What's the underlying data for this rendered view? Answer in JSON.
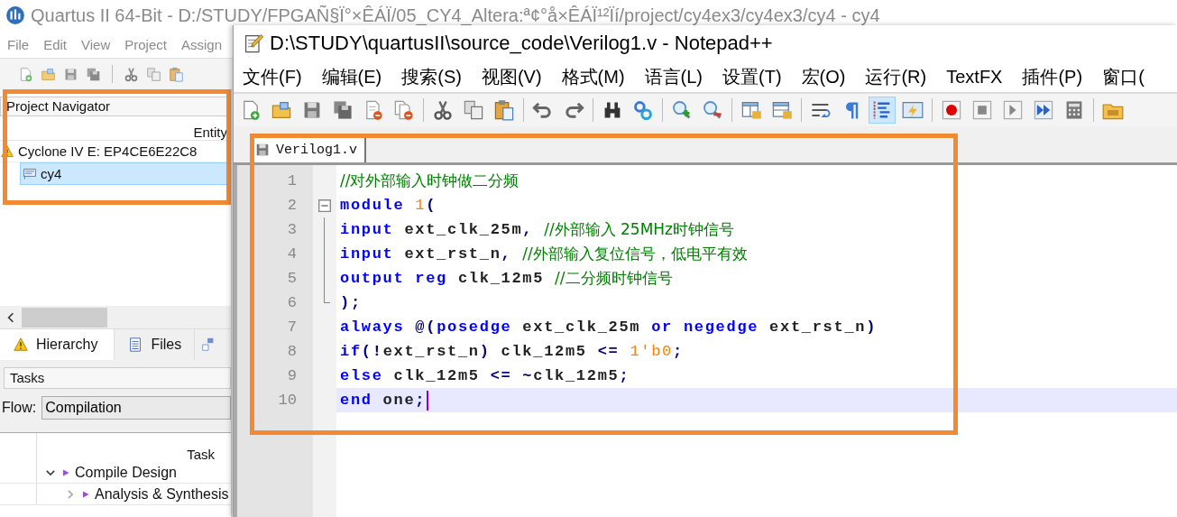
{
  "quartus": {
    "title": "Quartus II 64-Bit - D:/STUDY/FPGAÑ§Ï°×ÊÁÏ/05_CY4_Altera:ª¢°å×ÊÁÏ¹²Ïí/project/cy4ex3/cy4ex3/cy4 - cy4",
    "menu": [
      "File",
      "Edit",
      "View",
      "Project",
      "Assign"
    ],
    "toolbar": [
      {
        "kind": "new"
      },
      {
        "kind": "open"
      },
      {
        "kind": "save"
      },
      {
        "kind": "save-all"
      },
      {
        "kind": "separator"
      },
      {
        "kind": "cut"
      },
      {
        "kind": "copy"
      },
      {
        "kind": "paste"
      }
    ],
    "project_navigator": {
      "title": "Project Navigator",
      "highlighted": true,
      "column": "Entity",
      "tree": [
        {
          "label": "Cyclone IV E: EP4CE6E22C8",
          "kind": "device",
          "selected": false,
          "children": [
            {
              "label": "cy4",
              "kind": "entity",
              "selected": true
            }
          ]
        }
      ]
    },
    "tabs": [
      {
        "label": "Hierarchy",
        "kind": "hierarchy",
        "selected": true
      },
      {
        "label": "Files",
        "kind": "files",
        "selected": false
      },
      {
        "kind": "units",
        "selected": false
      }
    ],
    "tasks": {
      "title": "Tasks",
      "flow_label": "Flow:",
      "flow": "Compilation",
      "column": "Task",
      "rows": [
        {
          "label": "Compile Design",
          "expanded": true,
          "children": [
            {
              "label": "Analysis & Synthesis",
              "expanded": false
            }
          ]
        }
      ]
    }
  },
  "notepad": {
    "title": "D:\\STUDY\\quartusII\\source_code\\Verilog1.v - Notepad++",
    "menu": [
      "文件(F)",
      "编辑(E)",
      "搜索(S)",
      "视图(V)",
      "格式(M)",
      "语言(L)",
      "设置(T)",
      "宏(O)",
      "运行(R)",
      "TextFX",
      "插件(P)",
      "窗口("
    ],
    "toolbar": [
      {
        "kind": "new",
        "selected": false
      },
      {
        "kind": "open",
        "selected": false
      },
      {
        "kind": "save",
        "selected": false
      },
      {
        "kind": "save-all",
        "selected": false
      },
      {
        "kind": "close",
        "selected": false
      },
      {
        "kind": "close-all",
        "selected": false
      },
      {
        "kind": "separator"
      },
      {
        "kind": "cut",
        "selected": false
      },
      {
        "kind": "copy",
        "selected": false
      },
      {
        "kind": "paste",
        "selected": false
      },
      {
        "kind": "separator"
      },
      {
        "kind": "undo",
        "selected": false
      },
      {
        "kind": "redo",
        "selected": false
      },
      {
        "kind": "separator"
      },
      {
        "kind": "find",
        "selected": false
      },
      {
        "kind": "replace",
        "selected": false
      },
      {
        "kind": "separator"
      },
      {
        "kind": "zoom-in",
        "selected": false
      },
      {
        "kind": "zoom-out",
        "selected": false
      },
      {
        "kind": "separator"
      },
      {
        "kind": "sync-v",
        "selected": false
      },
      {
        "kind": "sync-h",
        "selected": false
      },
      {
        "kind": "separator"
      },
      {
        "kind": "wrap",
        "selected": false
      },
      {
        "kind": "all-chars",
        "selected": false
      },
      {
        "kind": "indent-guide",
        "selected": true
      },
      {
        "kind": "udl",
        "selected": false
      },
      {
        "kind": "separator"
      },
      {
        "kind": "record",
        "selected": false
      },
      {
        "kind": "stop",
        "selected": false
      },
      {
        "kind": "play",
        "selected": false
      },
      {
        "kind": "play-multi",
        "selected": false
      },
      {
        "kind": "save-macro",
        "selected": false
      },
      {
        "kind": "separator"
      },
      {
        "kind": "folder",
        "selected": false
      }
    ],
    "tabs": [
      {
        "label": "Verilog1.v",
        "selected": true
      }
    ],
    "editor": {
      "highlighted": true,
      "lines": [
        {
          "number": "1",
          "current": false,
          "tokens": [
            {
              "text": "//对外部输入时钟做二分频",
              "kind": "comment"
            }
          ]
        },
        {
          "number": "2",
          "current": false,
          "expanded": true,
          "tokens": [
            {
              "text": "module ",
              "kind": "keyword"
            },
            {
              "text": "1",
              "kind": "number"
            },
            {
              "text": "(",
              "kind": "op"
            }
          ],
          "children": [
            {
              "number": "3",
              "current": false,
              "tokens": [
                {
                  "text": "input",
                  "kind": "keyword"
                },
                {
                  "text": " ext_clk_25m",
                  "kind": "plain"
                },
                {
                  "text": ", ",
                  "kind": "op"
                },
                {
                  "text": "//外部输入 25MHz时钟信号",
                  "kind": "comment"
                }
              ]
            },
            {
              "number": "4",
              "current": false,
              "tokens": [
                {
                  "text": "input",
                  "kind": "keyword"
                },
                {
                  "text": " ext_rst_n",
                  "kind": "plain"
                },
                {
                  "text": ", ",
                  "kind": "op"
                },
                {
                  "text": "//外部输入复位信号，低电平有效",
                  "kind": "comment"
                }
              ]
            },
            {
              "number": "5",
              "current": false,
              "tokens": [
                {
                  "text": "output ",
                  "kind": "keyword"
                },
                {
                  "text": "reg",
                  "kind": "keyword"
                },
                {
                  "text": " clk_12m5 ",
                  "kind": "plain"
                },
                {
                  "text": "//二分频时钟信号",
                  "kind": "comment"
                }
              ]
            },
            {
              "number": "6",
              "current": false,
              "tokens": [
                {
                  "text": ");",
                  "kind": "op"
                }
              ]
            }
          ]
        },
        {
          "number": "7",
          "current": false,
          "tokens": [
            {
              "text": "always ",
              "kind": "keyword"
            },
            {
              "text": "@(",
              "kind": "op"
            },
            {
              "text": "posedge",
              "kind": "keyword"
            },
            {
              "text": " ext_clk_25m ",
              "kind": "plain"
            },
            {
              "text": "or ",
              "kind": "keyword"
            },
            {
              "text": "negedge",
              "kind": "keyword"
            },
            {
              "text": " ext_rst_n",
              "kind": "plain"
            },
            {
              "text": ")",
              "kind": "op"
            }
          ]
        },
        {
          "number": "8",
          "current": false,
          "tokens": [
            {
              "text": "if",
              "kind": "keyword"
            },
            {
              "text": "(!",
              "kind": "op"
            },
            {
              "text": "ext_rst_n",
              "kind": "plain"
            },
            {
              "text": ")",
              "kind": "op"
            },
            {
              "text": " clk_12m5 ",
              "kind": "plain"
            },
            {
              "text": "<= ",
              "kind": "op"
            },
            {
              "text": "1'b0",
              "kind": "number"
            },
            {
              "text": ";",
              "kind": "op"
            }
          ]
        },
        {
          "number": "9",
          "current": false,
          "tokens": [
            {
              "text": "else",
              "kind": "keyword"
            },
            {
              "text": " clk_12m5 ",
              "kind": "plain"
            },
            {
              "text": "<= ~",
              "kind": "op"
            },
            {
              "text": "clk_12m5",
              "kind": "plain"
            },
            {
              "text": ";",
              "kind": "op"
            }
          ]
        },
        {
          "number": "10",
          "current": true,
          "tokens": [
            {
              "text": "end",
              "kind": "keyword"
            },
            {
              "text": " one",
              "kind": "plain"
            },
            {
              "text": ";",
              "kind": "op"
            }
          ]
        }
      ]
    }
  }
}
